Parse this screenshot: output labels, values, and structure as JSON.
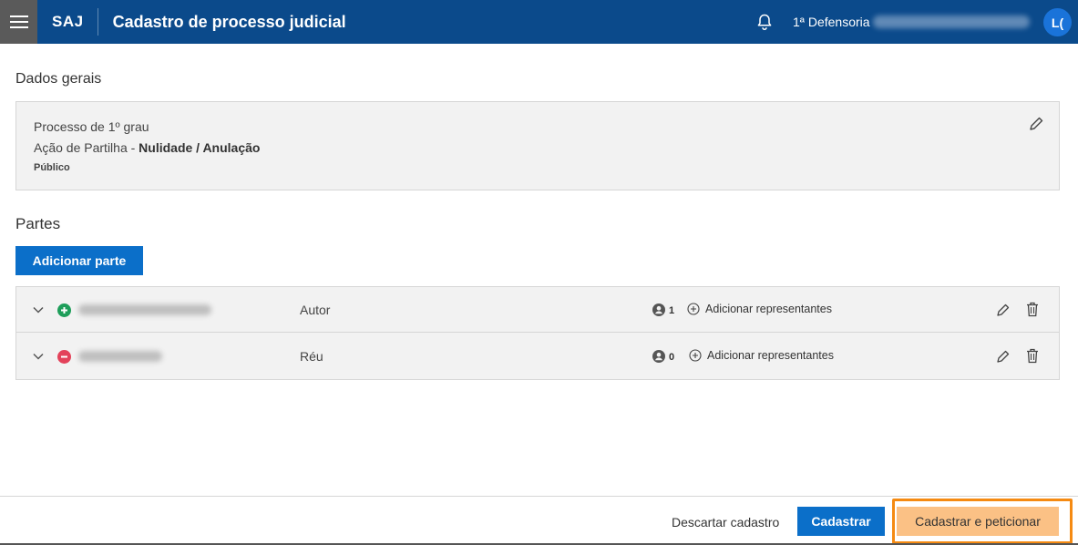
{
  "header": {
    "app_name": "SAJ",
    "page_title": "Cadastro de processo judicial",
    "unit_name": "1ª Defensoria",
    "avatar_initials": "L(",
    "background_color": "#0b4a8b"
  },
  "general": {
    "section_title": "Dados gerais",
    "instance": "Processo de 1º grau",
    "action_prefix": "Ação de Partilha - ",
    "action_detail": "Nulidade / Anulação",
    "visibility": "Público"
  },
  "parties": {
    "section_title": "Partes",
    "add_button_label": "Adicionar parte",
    "items": [
      {
        "status": "plus",
        "role": "Autor",
        "representatives_count": "1",
        "add_representatives_label": "Adicionar representantes"
      },
      {
        "status": "minus",
        "role": "Réu",
        "representatives_count": "0",
        "add_representatives_label": "Adicionar representantes"
      }
    ]
  },
  "footer": {
    "discard_label": "Descartar cadastro",
    "save_label": "Cadastrar",
    "save_and_petition_label": "Cadastrar e peticionar",
    "highlight_color": "#f58a12"
  }
}
